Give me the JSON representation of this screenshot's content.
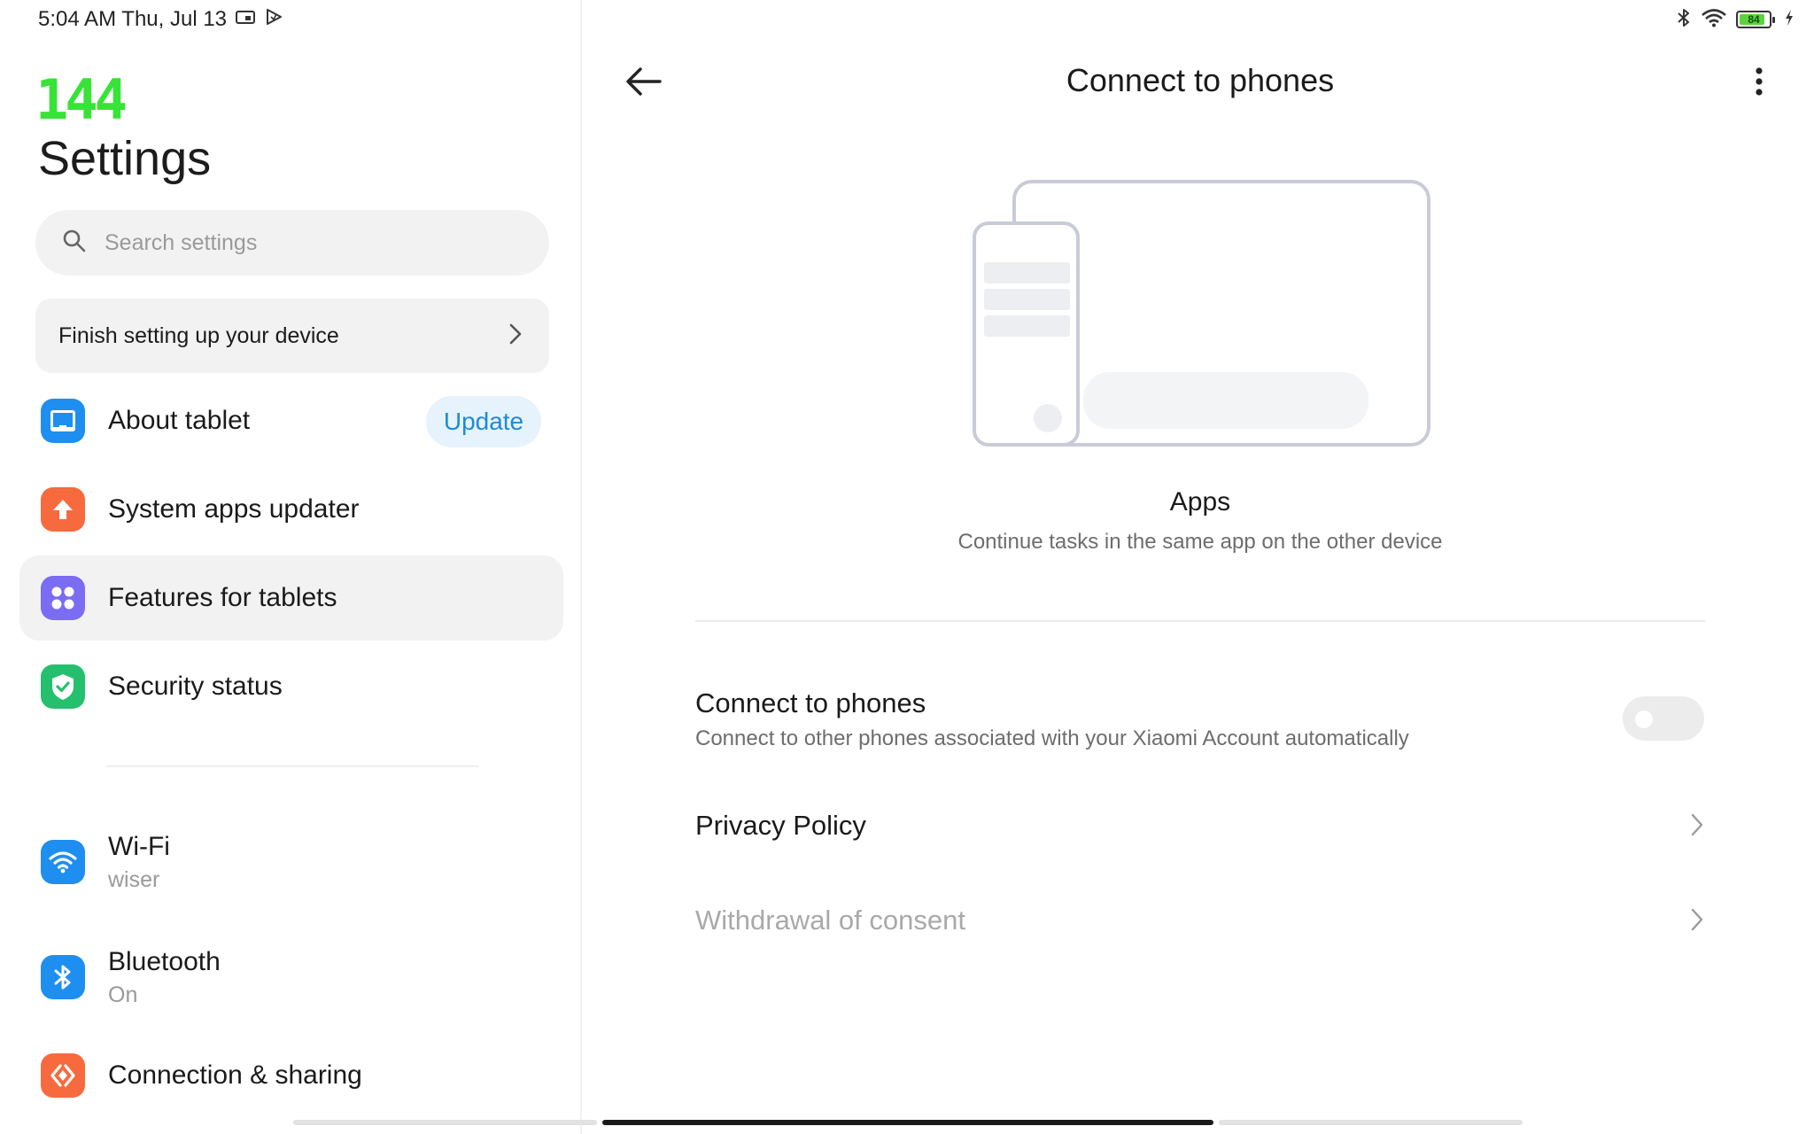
{
  "status_bar": {
    "time_date": "5:04 AM Thu, Jul 13",
    "battery_level": "84",
    "icons": [
      "display-icon",
      "play-protect-icon",
      "bluetooth-icon",
      "wifi-icon",
      "battery-icon",
      "charging-icon"
    ]
  },
  "sidebar": {
    "fps_counter": "144",
    "title": "Settings",
    "search": {
      "placeholder": "Search settings"
    },
    "finish_setup": {
      "label": "Finish setting up your device"
    },
    "items": [
      {
        "label": "About tablet",
        "action": "Update",
        "icon": "tablet-icon",
        "color": "#1e8ef0"
      },
      {
        "label": "System apps updater",
        "icon": "arrow-up-icon",
        "color": "#f76a3d"
      },
      {
        "label": "Features for tablets",
        "icon": "grid-icon",
        "color": "#7b6cf4",
        "active": true
      },
      {
        "label": "Security status",
        "icon": "shield-check-icon",
        "color": "#25c06d"
      },
      {
        "label": "Wi-Fi",
        "sublabel": "wiser",
        "icon": "wifi-icon",
        "color": "#1e8ef0"
      },
      {
        "label": "Bluetooth",
        "sublabel": "On",
        "icon": "bluetooth-icon",
        "color": "#1e8ef0"
      },
      {
        "label": "Connection & sharing",
        "icon": "connection-icon",
        "color": "#f76a3d"
      }
    ]
  },
  "main": {
    "title": "Connect to phones",
    "feature": {
      "title": "Apps",
      "description": "Continue tasks in the same app on the other device"
    },
    "connect_row": {
      "title": "Connect to phones",
      "description": "Connect to other phones associated with your Xiaomi Account automatically",
      "enabled": false
    },
    "privacy_row": {
      "title": "Privacy Policy"
    },
    "withdrawal_row": {
      "title": "Withdrawal of consent",
      "disabled": true
    }
  },
  "colors": {
    "accent": "#1e8ad6",
    "fps_green": "#37e336",
    "surface": "#f2f2f2"
  }
}
